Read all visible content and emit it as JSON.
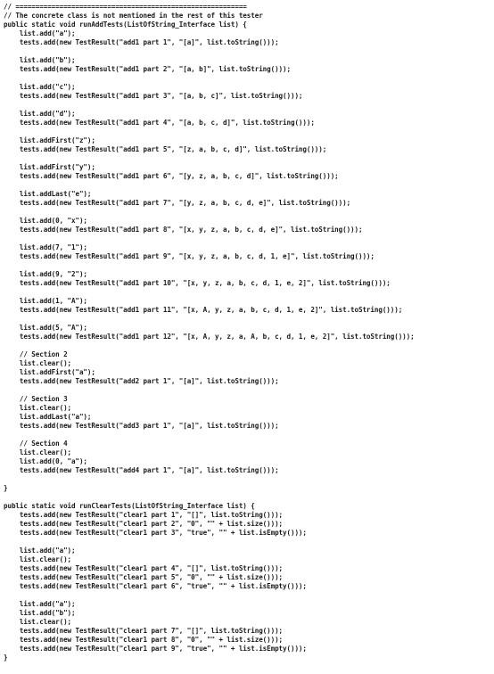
{
  "editor": {
    "lines": [
      "// ==========================================================",
      "// The concrete class is not mentioned in the rest of this tester",
      "public static void runAddTests(ListOfString_Interface list) {",
      "    list.add(\"a\");",
      "    tests.add(new TestResult(\"add1 part 1\", \"[a]\", list.toString()));",
      "",
      "    list.add(\"b\");",
      "    tests.add(new TestResult(\"add1 part 2\", \"[a, b]\", list.toString()));",
      "",
      "    list.add(\"c\");",
      "    tests.add(new TestResult(\"add1 part 3\", \"[a, b, c]\", list.toString()));",
      "",
      "    list.add(\"d\");",
      "    tests.add(new TestResult(\"add1 part 4\", \"[a, b, c, d]\", list.toString()));",
      "",
      "    list.addFirst(\"z\");",
      "    tests.add(new TestResult(\"add1 part 5\", \"[z, a, b, c, d]\", list.toString()));",
      "",
      "    list.addFirst(\"y\");",
      "    tests.add(new TestResult(\"add1 part 6\", \"[y, z, a, b, c, d]\", list.toString()));",
      "",
      "    list.addLast(\"e\");",
      "    tests.add(new TestResult(\"add1 part 7\", \"[y, z, a, b, c, d, e]\", list.toString()));",
      "",
      "    list.add(0, \"x\");",
      "    tests.add(new TestResult(\"add1 part 8\", \"[x, y, z, a, b, c, d, e]\", list.toString()));",
      "",
      "    list.add(7, \"1\");",
      "    tests.add(new TestResult(\"add1 part 9\", \"[x, y, z, a, b, c, d, 1, e]\", list.toString()));",
      "",
      "    list.add(9, \"2\");",
      "    tests.add(new TestResult(\"add1 part 10\", \"[x, y, z, a, b, c, d, 1, e, 2]\", list.toString()));",
      "",
      "    list.add(1, \"A\");",
      "    tests.add(new TestResult(\"add1 part 11\", \"[x, A, y, z, a, b, c, d, 1, e, 2]\", list.toString()));",
      "",
      "    list.add(5, \"A\");",
      "    tests.add(new TestResult(\"add1 part 12\", \"[x, A, y, z, a, A, b, c, d, 1, e, 2]\", list.toString()));",
      "",
      "    // Section 2",
      "    list.clear();",
      "    list.addFirst(\"a\");",
      "    tests.add(new TestResult(\"add2 part 1\", \"[a]\", list.toString()));",
      "",
      "    // Section 3",
      "    list.clear();",
      "    list.addLast(\"a\");",
      "    tests.add(new TestResult(\"add3 part 1\", \"[a]\", list.toString()));",
      "",
      "    // Section 4",
      "    list.clear();",
      "    list.add(0, \"a\");",
      "    tests.add(new TestResult(\"add4 part 1\", \"[a]\", list.toString()));",
      "",
      "}",
      "",
      "public static void runClearTests(ListOfString_Interface list) {",
      "    tests.add(new TestResult(\"clear1 part 1\", \"[]\", list.toString()));",
      "    tests.add(new TestResult(\"clear1 part 2\", \"0\", \"\" + list.size()));",
      "    tests.add(new TestResult(\"clear1 part 3\", \"true\", \"\" + list.isEmpty()));",
      "",
      "    list.add(\"a\");",
      "    list.clear();",
      "    tests.add(new TestResult(\"clear1 part 4\", \"[]\", list.toString()));",
      "    tests.add(new TestResult(\"clear1 part 5\", \"0\", \"\" + list.size()));",
      "    tests.add(new TestResult(\"clear1 part 6\", \"true\", \"\" + list.isEmpty()));",
      "",
      "    list.add(\"a\");",
      "    list.add(\"b\");",
      "    list.clear();",
      "    tests.add(new TestResult(\"clear1 part 7\", \"[]\", list.toString()));",
      "    tests.add(new TestResult(\"clear1 part 8\", \"0\", \"\" + list.size()));",
      "    tests.add(new TestResult(\"clear1 part 9\", \"true\", \"\" + list.isEmpty()));",
      "}"
    ]
  }
}
